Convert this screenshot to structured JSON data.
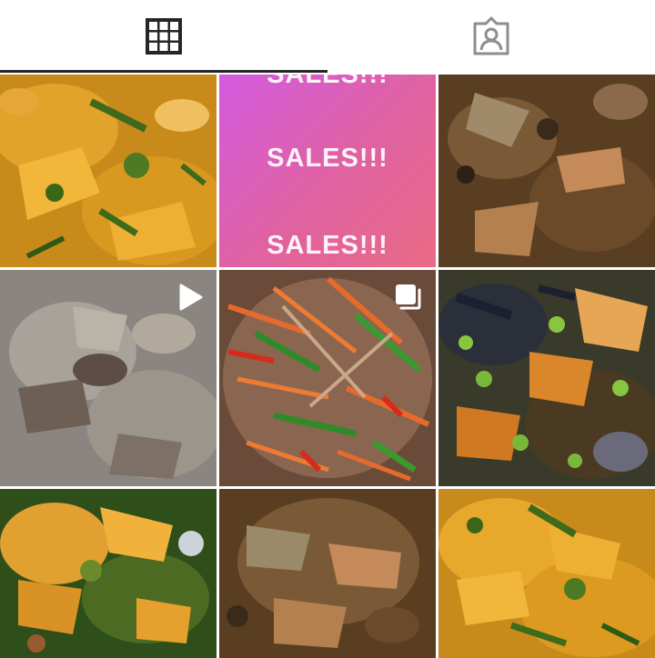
{
  "tabs": [
    {
      "label": "",
      "icon": "grid-icon",
      "active": true
    },
    {
      "label": "",
      "icon": "tagged-person-icon",
      "active": false
    }
  ],
  "posts": [
    {
      "icon": null,
      "kind": "photo",
      "theme": "egusi-yellow"
    },
    {
      "icon": null,
      "kind": "text",
      "lines": [
        "SALES!!!",
        "SALES!!!",
        "SALES!!!"
      ]
    },
    {
      "icon": null,
      "kind": "photo",
      "theme": "pepper-soup-brown"
    },
    {
      "icon": "video-play-icon",
      "kind": "video",
      "theme": "grey-soup"
    },
    {
      "icon": "carousel-icon",
      "kind": "carousel",
      "theme": "stir-fry"
    },
    {
      "icon": null,
      "kind": "photo",
      "theme": "okra-periwinkle"
    },
    {
      "icon": null,
      "kind": "photo",
      "theme": "vegetable-soup"
    },
    {
      "icon": null,
      "kind": "photo",
      "theme": "pepper-soup-brown"
    },
    {
      "icon": null,
      "kind": "photo",
      "theme": "egusi-yellow"
    }
  ],
  "colors": {
    "active_tab": "#262626",
    "icon_grey": "#8e8e8e",
    "sales_gradient_start": "#d35be0",
    "sales_gradient_end": "#ea6a86"
  }
}
